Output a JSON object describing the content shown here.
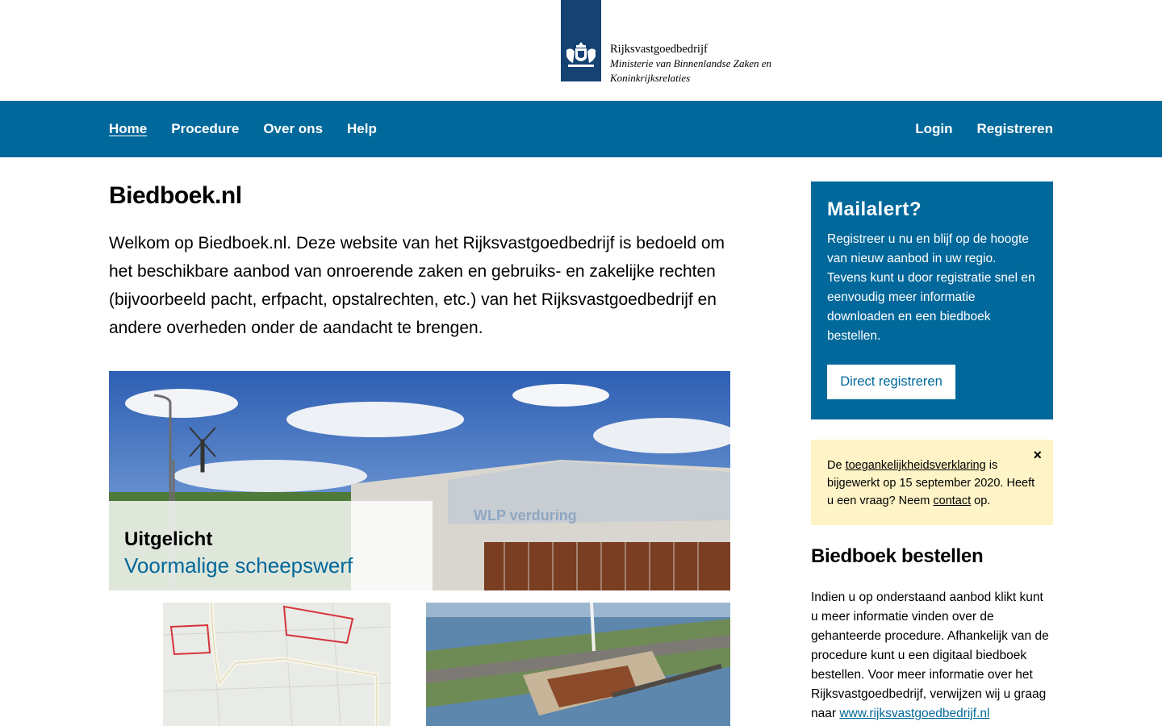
{
  "logo": {
    "organization": "Rijksvastgoedbedrijf",
    "ministry": "Ministerie van Binnenlandse Zaken en Koninkrijksrelaties",
    "icon": "coat-of-arms-icon",
    "color": "#154273"
  },
  "nav": {
    "left": [
      {
        "label": "Home",
        "active": true
      },
      {
        "label": "Procedure"
      },
      {
        "label": "Over ons"
      },
      {
        "label": "Help"
      }
    ],
    "right": [
      {
        "label": "Login"
      },
      {
        "label": "Registreren"
      }
    ],
    "color": "#01689b"
  },
  "main": {
    "title": "Biedboek.nl",
    "intro": "Welkom op Biedboek.nl. Deze website van het Rijksvastgoedbedrijf is bedoeld om het beschikbare aanbod van onroerende zaken en gebruiks- en zakelijke rechten (bijvoorbeeld pacht, erfpacht, opstalrechten, etc.) van het Rijksvastgoedbedrijf en andere overheden onder de aandacht te brengen.",
    "featured": {
      "kicker": "Uitgelicht",
      "title": "Voormalige scheepswerf",
      "sign_text": "WLP verduring"
    }
  },
  "sidebar": {
    "mailalert": {
      "title": "Mailalert?",
      "text": "Registreer u nu en blijf op de hoogte van nieuw aanbod in uw regio. Tevens kunt u door registratie snel en eenvoudig meer informatie downloaden en een biedboek bestellen.",
      "button": "Direct registreren"
    },
    "notice": {
      "prefix": "De ",
      "link1": "toegankelijkheidsverklaring",
      "middle": " is bijgewerkt op 15 september 2020. Heeft u een vraag? Neem ",
      "link2": "contact",
      "suffix": " op.",
      "close": "×",
      "color": "#fff4c7"
    },
    "order": {
      "title": "Biedboek bestellen",
      "text": "Indien u op onderstaand aanbod klikt kunt u meer informatie vinden over de gehanteerde procedure. Afhankelijk van de procedure kunt u een digitaal biedboek bestellen. Voor meer informatie over het Rijksvastgoedbedrijf, verwijzen wij u graag naar ",
      "link": "www.rijksvastgoedbedrijf.nl"
    }
  }
}
